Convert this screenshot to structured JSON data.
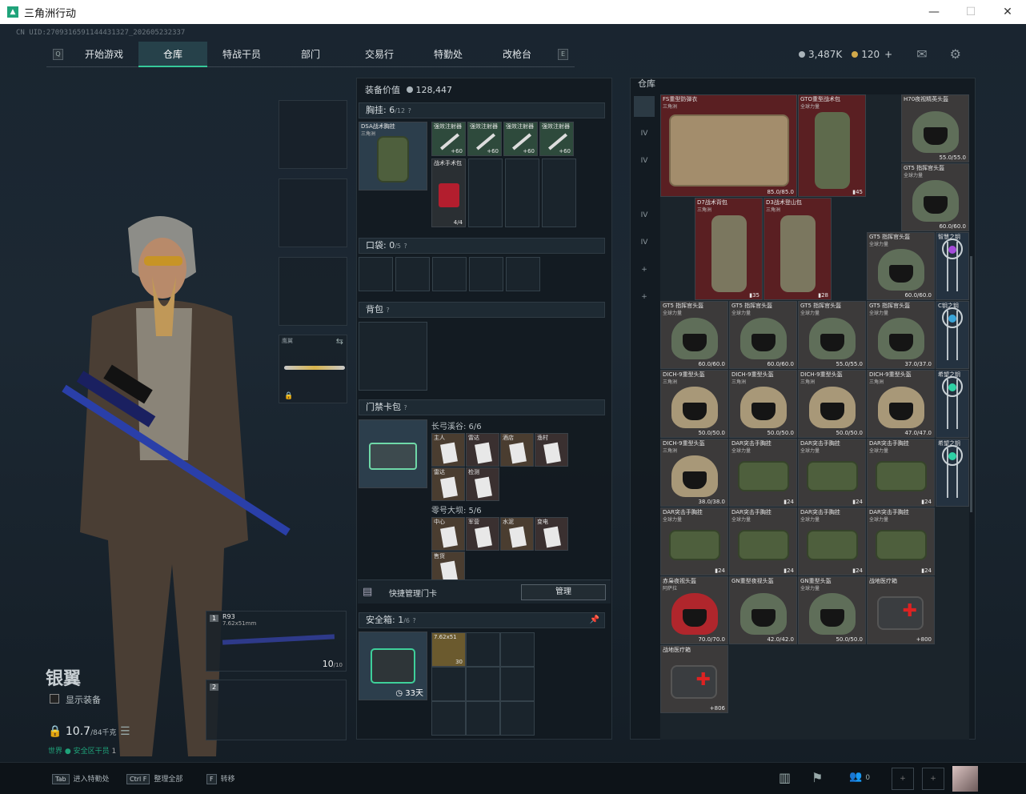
{
  "window": {
    "title": "三角洲行动"
  },
  "uid": "CN UID:2709316591144431327_202605232337",
  "nav": {
    "tabs": [
      {
        "label": "开始游戏"
      },
      {
        "label": "仓库",
        "active": true
      },
      {
        "label": "特战干员"
      },
      {
        "label": "部门",
        "badge": true
      },
      {
        "label": "交易行"
      },
      {
        "label": "特勤处",
        "badge": true
      },
      {
        "label": "改枪台"
      }
    ]
  },
  "currency": {
    "havoc": "3,487K",
    "coins": "120",
    "add": "+"
  },
  "character": {
    "name": "银翼",
    "show_equipment": "显示装备",
    "weight_value": "10.7",
    "weight_max": "/84千克",
    "status": "世界 ● 安全区干员",
    "status_count": "1"
  },
  "slots": {
    "melee_label": "鹰翼",
    "primary": {
      "index": "1",
      "name": "R93",
      "caliber": "7.62x51mm",
      "ammo": "10",
      "ammo_max": "/10"
    },
    "secondary": {
      "index": "2"
    }
  },
  "equipment": {
    "value_label": "装备价值",
    "value": "128,447",
    "chest": {
      "title": "胸挂:",
      "used": "6",
      "cap": "/12",
      "help": "?",
      "main_name": "DSA战术胸挂",
      "main_sub": "三角洲",
      "injectors": [
        {
          "name": "强效注射器",
          "val": "60"
        },
        {
          "name": "强效注射器",
          "val": "60"
        },
        {
          "name": "强效注射器",
          "val": "60"
        },
        {
          "name": "强效注射器",
          "val": "60"
        }
      ],
      "medkit": {
        "name": "战术手术包",
        "val": "4/4"
      }
    },
    "pocket": {
      "title": "口袋:",
      "used": "0",
      "cap": "/5",
      "help": "?"
    },
    "backpack": {
      "title": "背包",
      "help": "?"
    },
    "keycard": {
      "title": "门禁卡包",
      "help": "?",
      "group1": "长弓溪谷: 6/6",
      "group1_items": [
        "主人",
        "雷达",
        "酒店",
        "渔村",
        "雷达",
        "检测"
      ],
      "group2": "零号大坝: 5/6",
      "group2_items": [
        "中心",
        "军营",
        "水泥",
        "变电",
        "售货"
      ],
      "manage_label": "快捷管理门卡",
      "manage_button": "管理"
    },
    "safebox": {
      "title": "安全箱:",
      "used": "1",
      "cap": "/6",
      "help": "?",
      "days": "33天",
      "ammo_name": "7.62x51",
      "ammo_count": "30"
    }
  },
  "storage": {
    "title": "仓库",
    "side_items": [
      "",
      "IV",
      "IV",
      "",
      "IV",
      "IV",
      "+",
      "+",
      "",
      "",
      ""
    ],
    "items": [
      {
        "name": "FS重型防弹衣",
        "sub": "三角洲",
        "val": "85.0/85.0",
        "type": "vest"
      },
      {
        "name": "GTO重型战术包",
        "sub": "全球力量",
        "val": "",
        "type": "bag",
        "cnt": "45"
      },
      {
        "name": "H70夜视精英头盔",
        "sub": "",
        "val": "55.0/55.0",
        "type": "helmet"
      },
      {
        "name": "GT5 指挥官头盔",
        "sub": "全球力量",
        "val": "60.0/60.0",
        "type": "helmet"
      },
      {
        "name": "D7战术背包",
        "sub": "三角洲",
        "val": "",
        "type": "bag",
        "cnt": "35"
      },
      {
        "name": "D3战术登山包",
        "sub": "三角洲",
        "val": "",
        "type": "bag",
        "cnt": "28"
      },
      {
        "name": "GT5 指挥官头盔",
        "sub": "全球力量",
        "val": "60.0/60.0",
        "type": "helmet"
      },
      {
        "name": "智慧之钥",
        "sub": "",
        "val": "",
        "type": "key",
        "color": "#a44bdb"
      },
      {
        "name": "GT5 指挥官头盔",
        "sub": "全球力量",
        "val": "60.0/60.0",
        "type": "helmet"
      },
      {
        "name": "GT5 指挥官头盔",
        "sub": "全球力量",
        "val": "60.0/60.0",
        "type": "helmet"
      },
      {
        "name": "GT5 指挥官头盔",
        "sub": "全球力量",
        "val": "55.0/55.0",
        "type": "helmet"
      },
      {
        "name": "GT5 指挥官头盔",
        "sub": "全球力量",
        "val": "37.0/37.0",
        "type": "helmet"
      },
      {
        "name": "C钥之钥",
        "sub": "",
        "val": "",
        "type": "key",
        "color": "#3aa4d8"
      },
      {
        "name": "DICH-9重型头盔",
        "sub": "三角洲",
        "val": "50.0/50.0",
        "type": "helmet"
      },
      {
        "name": "DICH-9重型头盔",
        "sub": "三角洲",
        "val": "50.0/50.0",
        "type": "helmet"
      },
      {
        "name": "DICH-9重型头盔",
        "sub": "三角洲",
        "val": "50.0/50.0",
        "type": "helmet"
      },
      {
        "name": "DICH-9重型头盔",
        "sub": "三角洲",
        "val": "47.0/47.0",
        "type": "helmet"
      },
      {
        "name": "希望之钥",
        "sub": "",
        "val": "",
        "type": "key",
        "color": "#2fd1a5"
      },
      {
        "name": "DICH-9重型头盔",
        "sub": "三角洲",
        "val": "38.0/38.0",
        "type": "helmet"
      },
      {
        "name": "DAR突击手胸挂",
        "sub": "全球力量",
        "val": "",
        "type": "vest",
        "cnt": "24"
      },
      {
        "name": "DAR突击手胸挂",
        "sub": "全球力量",
        "val": "",
        "type": "vest",
        "cnt": "24"
      },
      {
        "name": "DAR突击手胸挂",
        "sub": "全球力量",
        "val": "",
        "type": "vest",
        "cnt": "24"
      },
      {
        "name": "希望之钥",
        "sub": "",
        "val": "",
        "type": "key",
        "color": "#2fd1a5"
      },
      {
        "name": "DAR突击手胸挂",
        "sub": "全球力量",
        "val": "",
        "type": "vest",
        "cnt": "24"
      },
      {
        "name": "DAR突击手胸挂",
        "sub": "全球力量",
        "val": "",
        "type": "vest",
        "cnt": "24"
      },
      {
        "name": "DAR突击手胸挂",
        "sub": "全球力量",
        "val": "",
        "type": "vest",
        "cnt": "24"
      },
      {
        "name": "DAR突击手胸挂",
        "sub": "全球力量",
        "val": "",
        "type": "vest",
        "cnt": "24"
      },
      {
        "name": "赤枭夜视头盔",
        "sub": "阿萨拉",
        "val": "70.0/70.0",
        "type": "helmet"
      },
      {
        "name": "GN重型夜视头盔",
        "sub": "",
        "val": "42.0/42.0",
        "type": "helmet"
      },
      {
        "name": "GN重型头盔",
        "sub": "全球力量",
        "val": "50.0/50.0",
        "type": "helmet"
      },
      {
        "name": "战地医疗箱",
        "sub": "",
        "val": "800",
        "type": "medkit"
      },
      {
        "name": "战地医疗箱",
        "sub": "",
        "val": "806",
        "type": "medkit"
      }
    ]
  },
  "bottom": {
    "hint1_key": "Tab",
    "hint1": "进入特勤处",
    "hint2_key": "Ctrl F",
    "hint2": "整理全部",
    "hint3_key": "F",
    "hint3": "转移",
    "friends": "0"
  }
}
